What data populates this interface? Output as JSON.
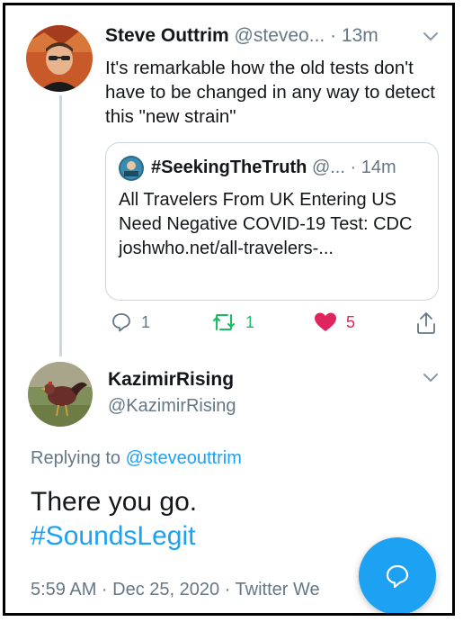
{
  "tweet1": {
    "name": "Steve Outtrim",
    "handle": "@steveo...",
    "time": "13m",
    "text": "It's remarkable how the old tests don't have to be changed in any way to detect this \"new strain\"",
    "quoted": {
      "name": "#SeekingTheTruth",
      "handle": "@...",
      "time": "14m",
      "text": "All Travelers From UK Entering US Need Negative COVID-19 Test: CDC joshwho.net/all-travelers-..."
    },
    "actions": {
      "reply_count": "1",
      "retweet_count": "1",
      "like_count": "5"
    }
  },
  "tweet2": {
    "name": "KazimirRising",
    "handle": "@KazimirRising",
    "replying_prefix": "Replying to",
    "replying_mention": "@steveouttrim",
    "text": "There you go.",
    "hashtag": "#SoundsLegit",
    "footer": "5:59 AM · Dec 25, 2020 · Twitter We"
  },
  "colors": {
    "accent": "#1da1f2",
    "retweet": "#17bf63",
    "like": "#e0245e",
    "muted": "#657786"
  },
  "icons": {
    "compose": "chat-bubble-icon"
  }
}
